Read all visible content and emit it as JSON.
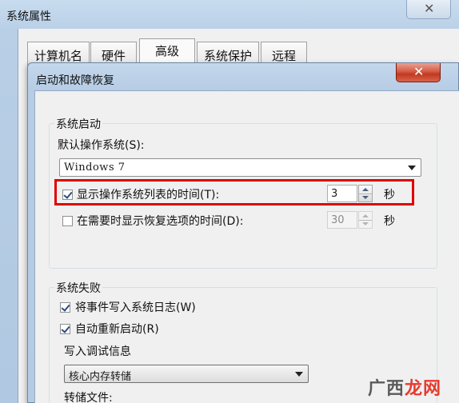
{
  "outer_window": {
    "title": "系统属性",
    "close_label": "✕",
    "tabs": [
      "计算机名",
      "硬件",
      "高级",
      "系统保护",
      "远程"
    ],
    "active_tab": "高级"
  },
  "dialog": {
    "title": "启动和故障恢复",
    "close_label": "✕",
    "startup": {
      "legend": "系统启动",
      "default_os_label": "默认操作系统(S):",
      "default_os_value": "Windows 7",
      "show_list_label": "显示操作系统列表的时间(T):",
      "show_list_checked": true,
      "show_list_value": "3",
      "show_recovery_label": "在需要时显示恢复选项的时间(D):",
      "show_recovery_checked": false,
      "show_recovery_value": "30",
      "seconds_unit": "秒"
    },
    "failure": {
      "legend": "系统失败",
      "write_event_label": "将事件写入系统日志(W)",
      "write_event_checked": true,
      "auto_restart_label": "自动重新启动(R)",
      "auto_restart_checked": true,
      "debug_info_label": "写入调试信息",
      "debug_info_value": "核心内存转储",
      "dump_file_label": "转储文件:"
    }
  },
  "watermark": {
    "prefix": "广西",
    "accent": "龙网"
  },
  "colors": {
    "highlight": "#e00000",
    "titlebar": "#b7cde5",
    "close_red": "#c2391f"
  }
}
